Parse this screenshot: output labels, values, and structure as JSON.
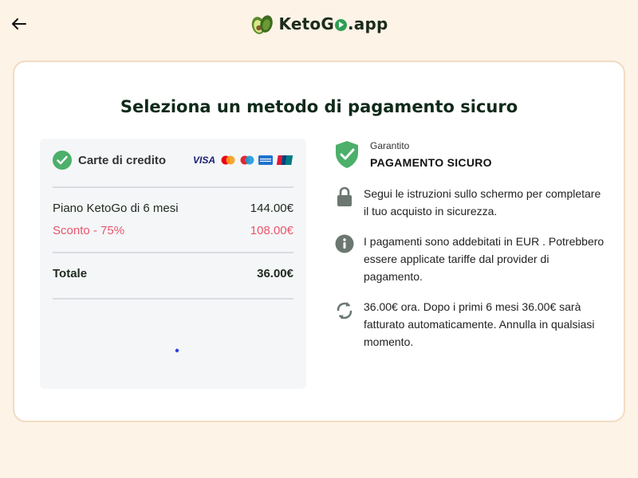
{
  "header": {
    "back_icon": "arrow-left-icon",
    "logo_icon": "avocado-icon",
    "logo_prefix": "KetoG",
    "logo_suffix": ".app"
  },
  "page": {
    "title": "Seleziona un metodo di pagamento sicuro"
  },
  "payment": {
    "method_label": "Carte di credito",
    "card_brands": [
      "VISA",
      "Mastercard",
      "Maestro",
      "American Express",
      "UnionPay"
    ],
    "visa_label": "VISA",
    "plan_label": "Piano KetoGo di 6 mesi",
    "plan_price": "144.00€",
    "discount_label": "Sconto -  75%",
    "discount_price": "108.00€",
    "total_label": "Totale",
    "total_price": "36.00€"
  },
  "info": {
    "secure_small": "Garantito",
    "secure_big": "PAGAMENTO SICURO",
    "items": [
      {
        "icon": "lock-icon",
        "text": "Segui le istruzioni sullo schermo per completare il tuo acquisto in sicurezza."
      },
      {
        "icon": "info-icon",
        "text": "I pagamenti sono addebitati in EUR . Potrebbero essere applicate tariffe dal provider di pagamento."
      },
      {
        "icon": "refresh-icon",
        "text": "36.00€ ora. Dopo i primi 6 mesi 36.00€ sarà fatturato automaticamente. Annulla in qualsiasi momento."
      }
    ]
  },
  "colors": {
    "background": "#fdf3e7",
    "accent_green": "#4caf6a",
    "discount_red": "#e8566c",
    "icon_gray": "#6b7770"
  }
}
